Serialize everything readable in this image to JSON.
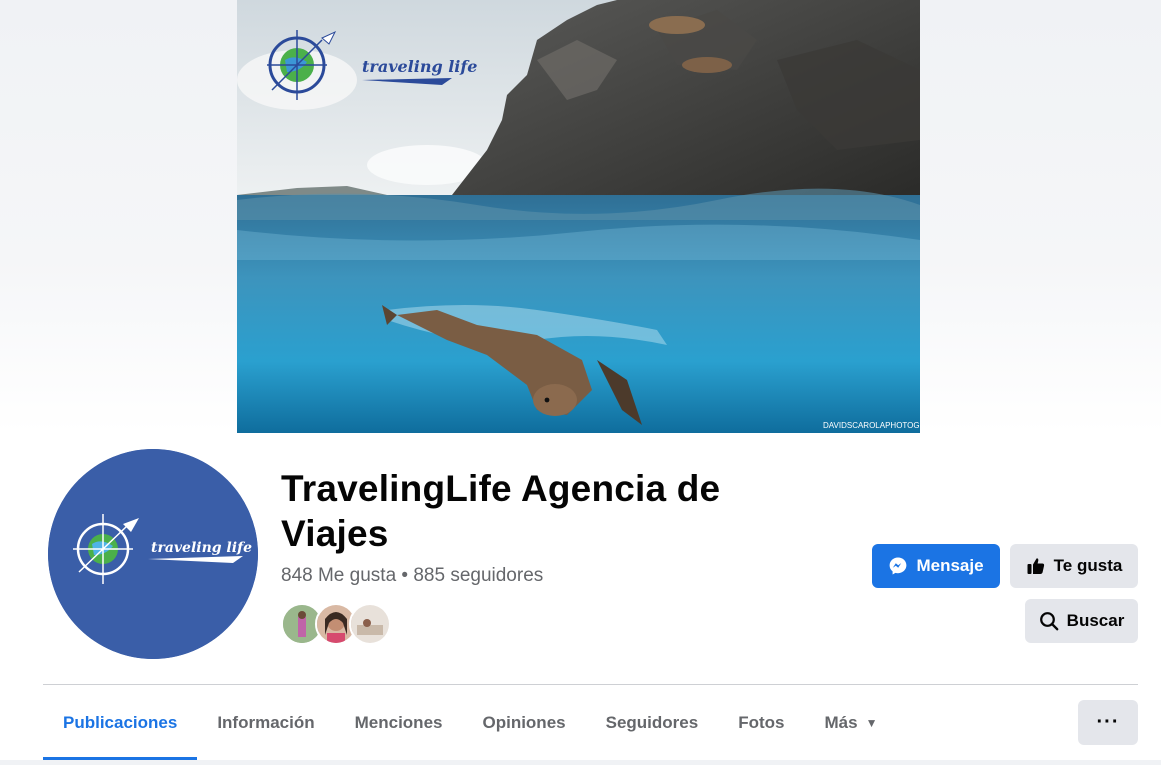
{
  "cover": {
    "brand_text": "traveling life",
    "photo_credit": "DAVIDSCAROLAPHOTOGRAPHY"
  },
  "profile": {
    "avatar_brand_text": "traveling life",
    "name_line1": "TravelingLife Agencia de",
    "name_line2": "Viajes",
    "stats": "848 Me gusta • 885 seguidores"
  },
  "actions": {
    "message_label": "Mensaje",
    "like_label": "Te gusta",
    "search_label": "Buscar"
  },
  "tabs": [
    {
      "label": "Publicaciones",
      "active": true
    },
    {
      "label": "Información"
    },
    {
      "label": "Menciones"
    },
    {
      "label": "Opiniones"
    },
    {
      "label": "Seguidores"
    },
    {
      "label": "Fotos"
    },
    {
      "label": "Más"
    }
  ],
  "more_menu_label": "···",
  "colors": {
    "primary": "#1b74e4",
    "secondary_bg": "#e4e6eb",
    "muted_text": "#65676b",
    "avatar_bg": "#3a5ea8"
  },
  "icons": {
    "message": "messenger-icon",
    "like": "thumbs-up-icon",
    "search": "search-icon",
    "more_caret": "caret-down-icon",
    "ellipsis": "ellipsis-icon"
  }
}
